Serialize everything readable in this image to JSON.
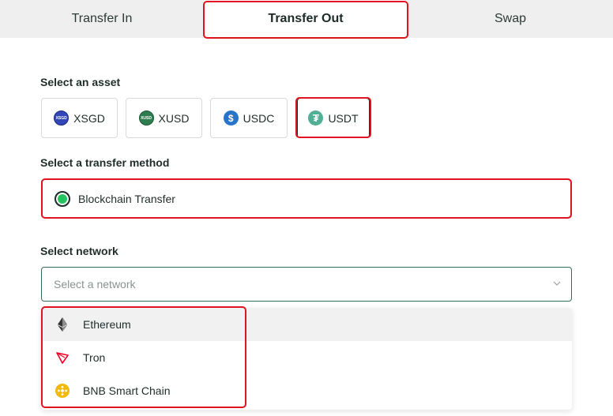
{
  "tabs": [
    {
      "label": "Transfer In"
    },
    {
      "label": "Transfer Out"
    },
    {
      "label": "Swap"
    }
  ],
  "asset_section": {
    "label": "Select an asset",
    "assets": [
      {
        "label": "XSGD",
        "icon": "xsgd-coin-icon",
        "icon_text": "XSGD"
      },
      {
        "label": "XUSD",
        "icon": "xusd-coin-icon",
        "icon_text": "XUSD"
      },
      {
        "label": "USDC",
        "icon": "usdc-coin-icon",
        "icon_text": "$"
      },
      {
        "label": "USDT",
        "icon": "usdt-coin-icon",
        "icon_text": "₮"
      }
    ],
    "selected": "USDT"
  },
  "method_section": {
    "label": "Select a transfer method",
    "option": "Blockchain Transfer"
  },
  "network_section": {
    "label": "Select network",
    "placeholder": "Select a network",
    "options": [
      {
        "label": "Ethereum",
        "icon": "ethereum-icon"
      },
      {
        "label": "Tron",
        "icon": "tron-icon"
      },
      {
        "label": "BNB Smart Chain",
        "icon": "bnb-icon"
      }
    ]
  },
  "colors": {
    "highlight": "#e0141e",
    "radio_fill": "#22c55e",
    "tab_bar": "#efefef",
    "select_border": "#2f6d5c"
  }
}
